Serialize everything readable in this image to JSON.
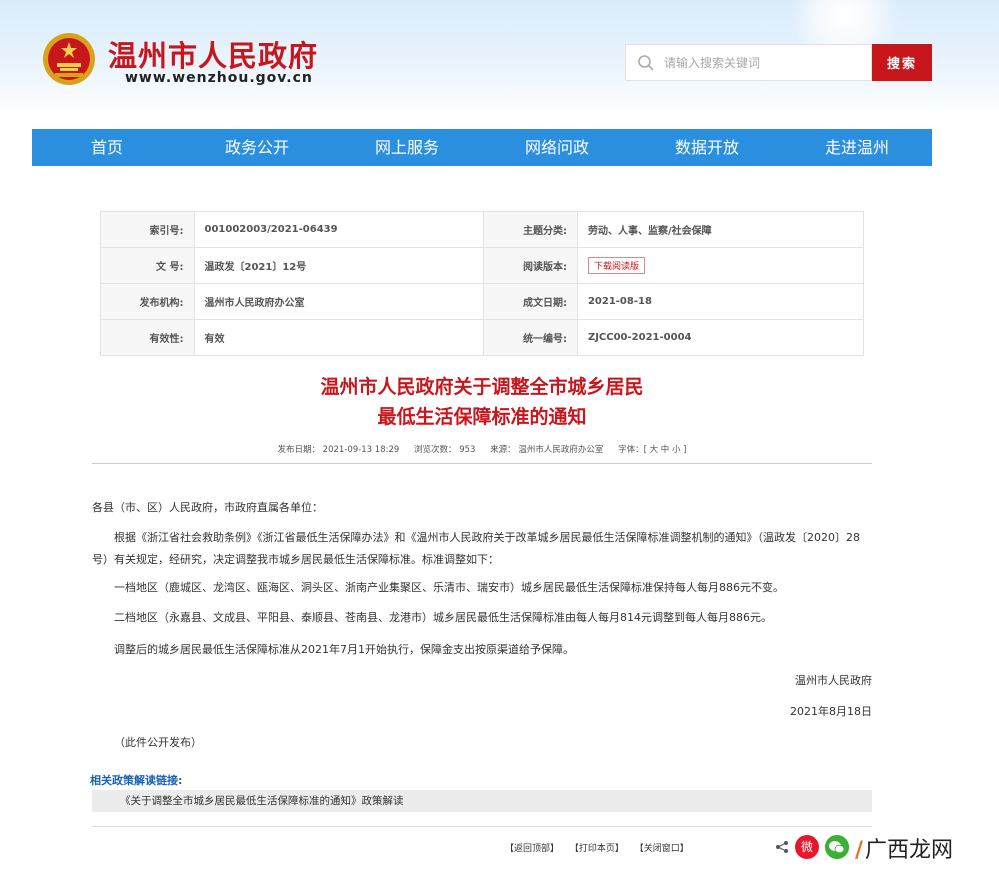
{
  "header": {
    "site_title": "温州市人民政府",
    "site_url": "www.wenzhou.gov.cn",
    "search_placeholder": "请输入搜索关键词",
    "search_button": "搜索"
  },
  "nav": {
    "items": [
      "首页",
      "政务公开",
      "网上服务",
      "网络问政",
      "数据开放",
      "走进温州"
    ]
  },
  "meta": {
    "index_label": "索引号:",
    "index_value": "001002003/2021-06439",
    "topic_label": "主题分类:",
    "topic_value": "劳动、人事、监察/社会保障",
    "docno_label": "文 号:",
    "docno_value": "温政发〔2021〕12号",
    "read_label": "阅读版本:",
    "read_button": "下载阅读版",
    "issuer_label": "发布机构:",
    "issuer_value": "温州市人民政府办公室",
    "date_label": "成文日期:",
    "date_value": "2021-08-18",
    "validity_label": "有效性:",
    "validity_value": "有效",
    "code_label": "统一编号:",
    "code_value": "ZJCC00-2021-0004"
  },
  "doc": {
    "title_line1": "温州市人民政府关于调整全市城乡居民",
    "title_line2": "最低生活保障标准的通知",
    "publish_date": "发布日期： 2021-09-13 18:29",
    "views": "浏览次数： 953",
    "source": "来源： 温州市人民政府办公室",
    "font_size": "字体：[ 大 中 小 ]",
    "salutation": "各县（市、区）人民政府，市政府直属各单位：",
    "para1": "根据《浙江省社会救助条例》《浙江省最低生活保障办法》和《温州市人民政府关于改革城乡居民最低生活保障标准调整机制的通知》（温政发〔2020〕28号）有关规定，经研究，决定调整我市城乡居民最低生活保障标准。标准调整如下：",
    "para2": "一档地区（鹿城区、龙湾区、瓯海区、洞头区、浙南产业集聚区、乐清市、瑞安市）城乡居民最低生活保障标准保持每人每月886元不变。",
    "para3": "二档地区（永嘉县、文成县、平阳县、泰顺县、苍南县、龙港市）城乡居民最低生活保障标准由每人每月814元调整到每人每月886元。",
    "para4": "调整后的城乡居民最低生活保障标准从2021年7月1开始执行，保障金支出按原渠道给予保障。",
    "signature": "温州市人民政府",
    "sign_date": "2021年8月18日",
    "release_note": "（此件公开发布）"
  },
  "related": {
    "title": "相关政策解读链接:",
    "link": "《关于调整全市城乡居民最低生活保障标准的通知》政策解读"
  },
  "footer": {
    "back_top": "【返回顶部】",
    "print": "【打印本页】",
    "close": "【关闭窗口】",
    "weibo": "微",
    "watermark_mark": "/",
    "watermark_text": "广西龙网"
  }
}
